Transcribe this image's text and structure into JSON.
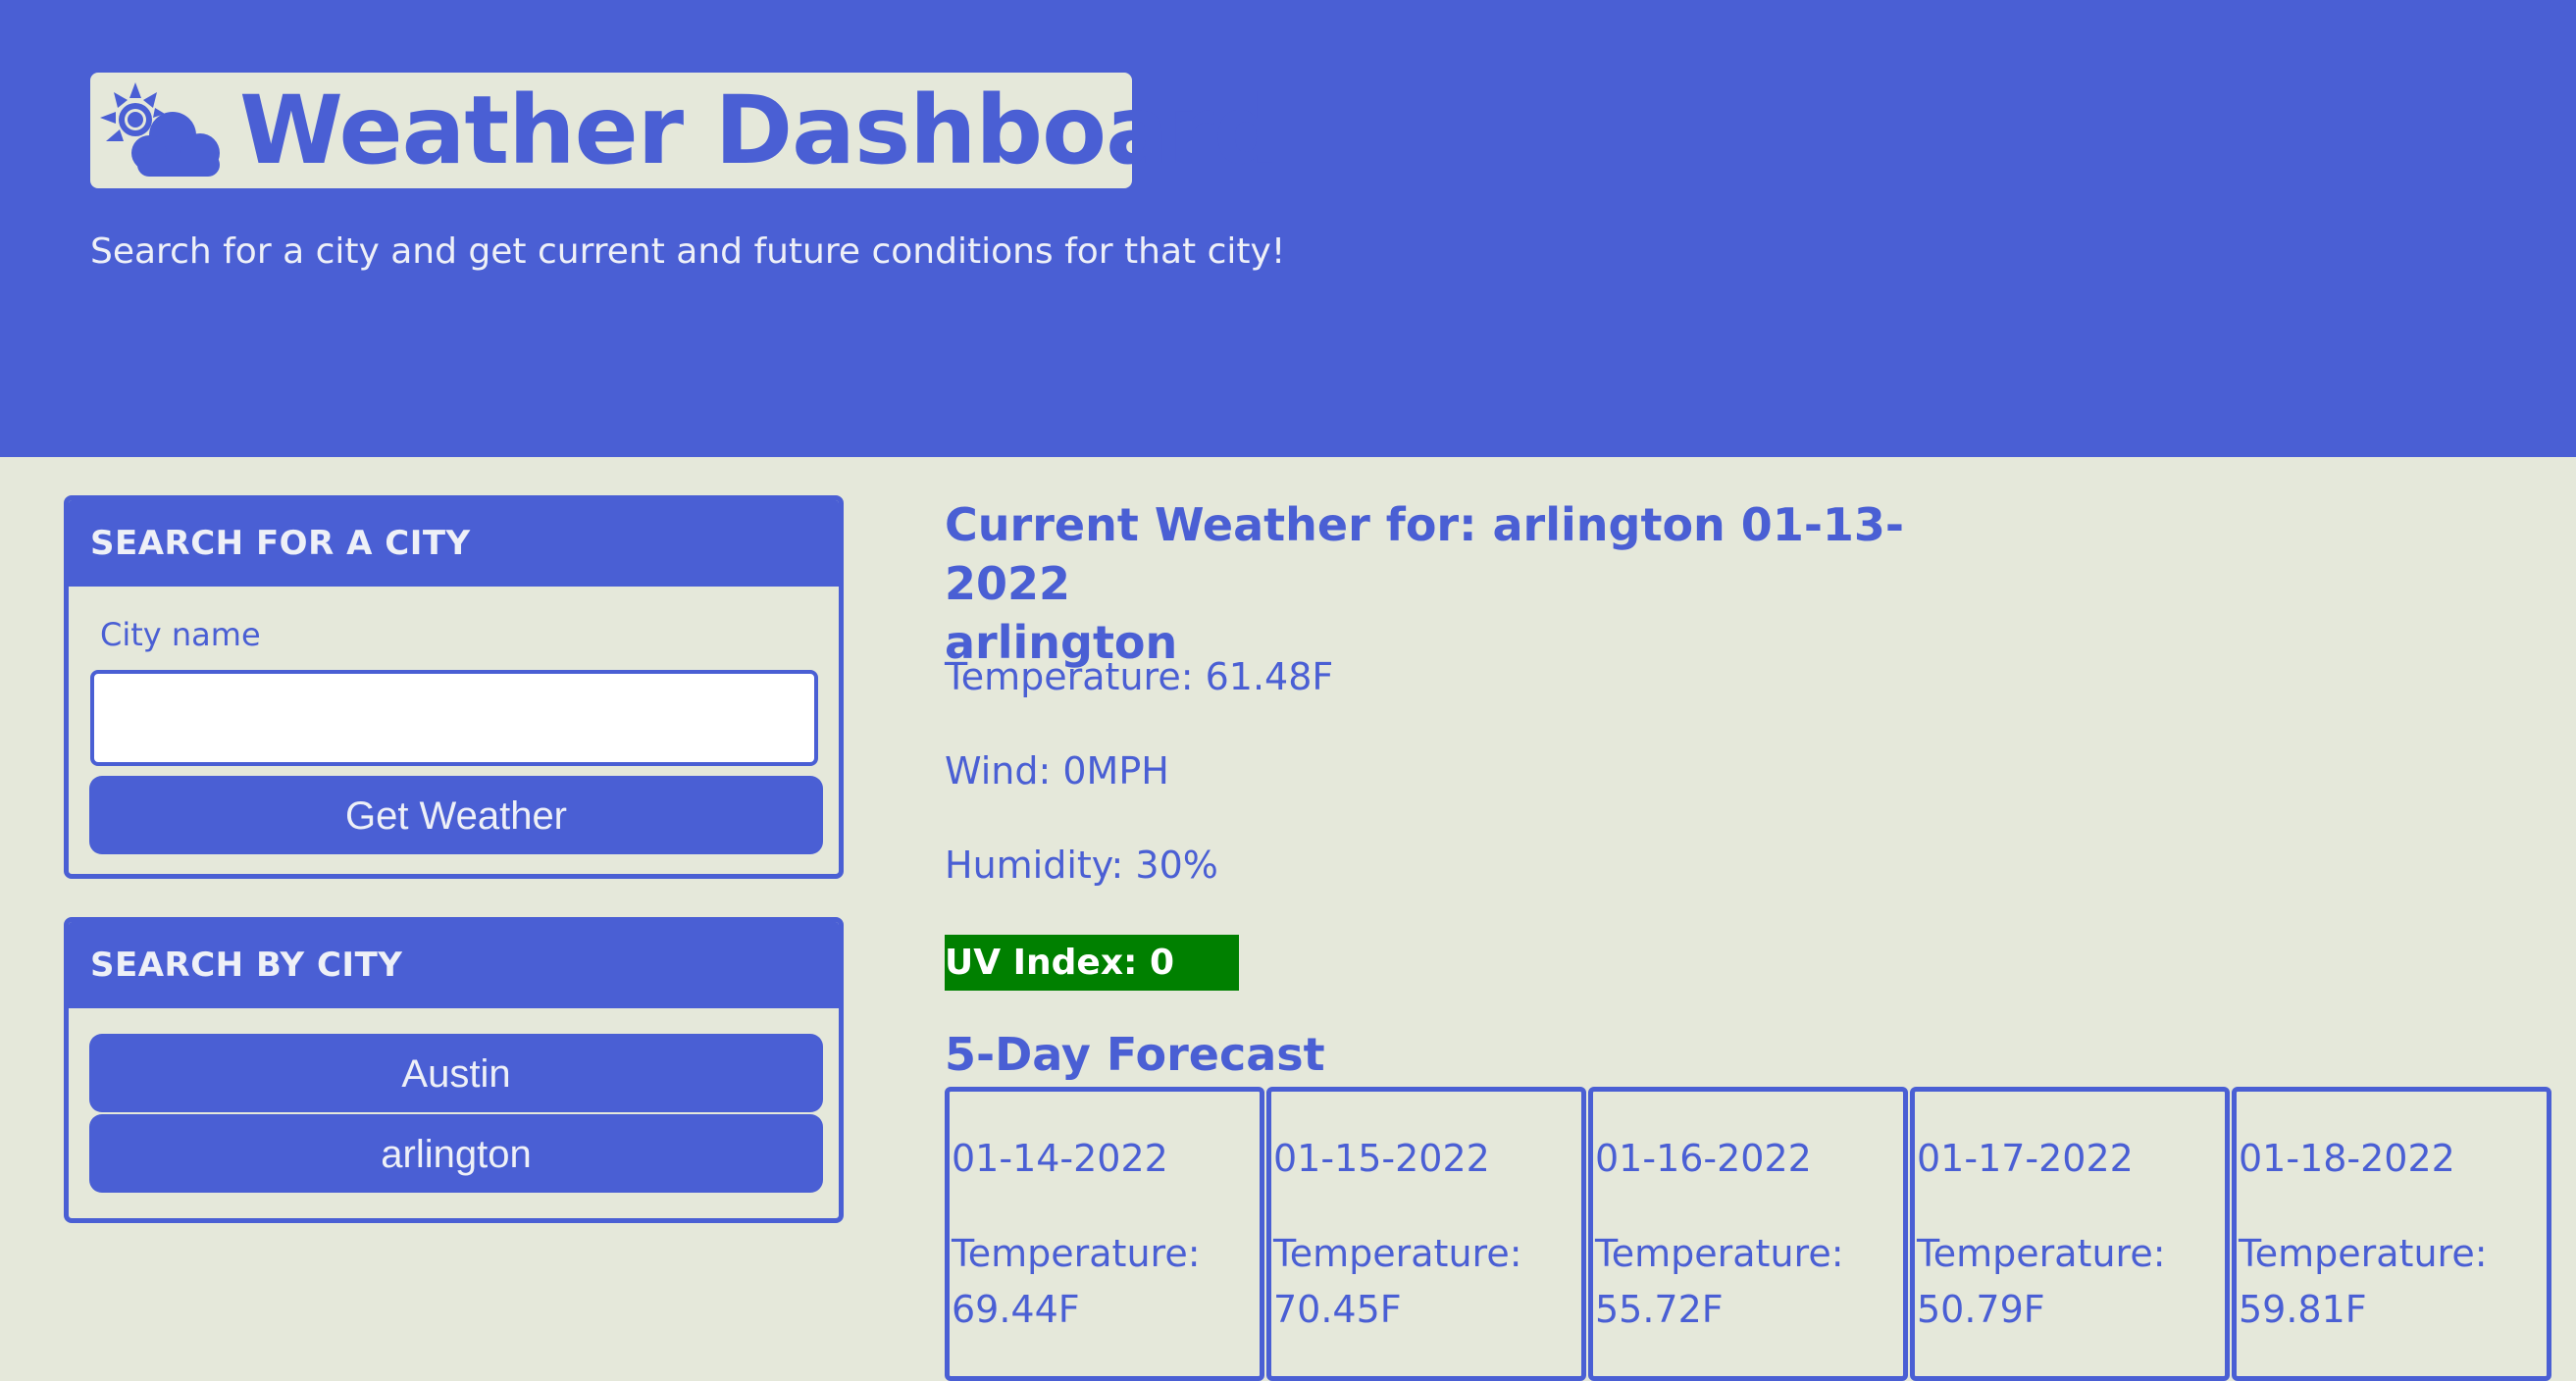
{
  "header": {
    "title": "Weather Dashboard",
    "icon": "sun-behind-cloud-icon",
    "subtitle": "Search for a city and get current and future conditions for that city!"
  },
  "search_panel": {
    "heading": "SEARCH FOR A CITY",
    "field_label": "City name",
    "input_value": "",
    "input_placeholder": "",
    "button_label": "Get Weather"
  },
  "history_panel": {
    "heading": "SEARCH BY CITY",
    "cities": [
      "Austin",
      "arlington"
    ]
  },
  "current": {
    "title_line1": "Current Weather for: arlington 01-13-2022",
    "title_line2": "arlington",
    "temperature": "Temperature: 61.48F",
    "wind": "Wind: 0MPH",
    "humidity": "Humidity: 30%",
    "uv": "UV Index: 0",
    "uv_color": "#008000"
  },
  "forecast": {
    "title": "5-Day Forecast",
    "days": [
      {
        "date": "01-14-2022",
        "temp_label": "Temperature:",
        "temp_value": "69.44F"
      },
      {
        "date": "01-15-2022",
        "temp_label": "Temperature:",
        "temp_value": "70.45F"
      },
      {
        "date": "01-16-2022",
        "temp_label": "Temperature:",
        "temp_value": "55.72F"
      },
      {
        "date": "01-17-2022",
        "temp_label": "Temperature:",
        "temp_value": "50.79F"
      },
      {
        "date": "01-18-2022",
        "temp_label": "Temperature:",
        "temp_value": "59.81F"
      }
    ]
  },
  "colors": {
    "accent": "#4a5fd4",
    "background": "#e5e8da",
    "uv_good": "#008000"
  }
}
